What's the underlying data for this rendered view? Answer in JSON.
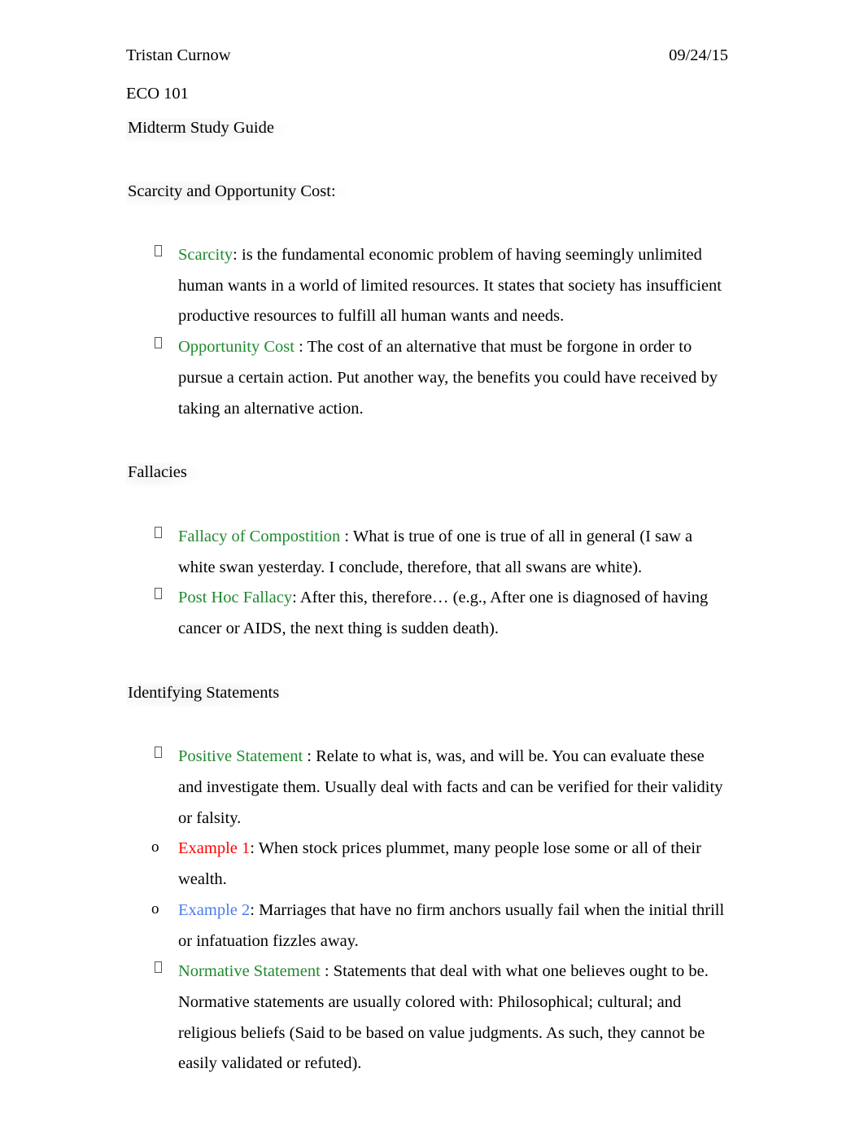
{
  "document": {
    "author": "Tristan Curnow",
    "date": "09/24/15",
    "course": "ECO 101",
    "subtitle": "Midterm Study Guide"
  },
  "sections": [
    {
      "heading": "Scarcity and Opportunity Cost:",
      "items": [
        {
          "term": "Scarcity",
          "term_color": "#1f8a2e",
          "body": ": is the fundamental economic problem of having seemingly unlimited human wants in a world of limited resources. It states that society has insufficient productive resources to fulfill all human wants and needs."
        },
        {
          "term": "Opportunity Cost ",
          "term_color": "#1f8a2e",
          "body": ": The cost of an alternative that must be forgone in order to pursue a certain action. Put another way, the benefits you could have received by taking an alternative action."
        }
      ]
    },
    {
      "heading": "Fallacies",
      "items": [
        {
          "term": "Fallacy of Compostition ",
          "term_color": "#1f8a2e",
          "body": ": What is true of one is true of all in general (I saw a white swan yesterday. I conclude, therefore, that all swans are white)."
        },
        {
          "term": "Post Hoc Fallacy",
          "term_color": "#1f8a2e",
          "body": ": After this, therefore… (e.g., After one is diagnosed of having cancer or AIDS, the next thing is sudden death)."
        }
      ]
    },
    {
      "heading": "Identifying Statements",
      "items": [
        {
          "term": "Positive Statement  ",
          "term_color": "#1f8a2e",
          "body": ": Relate to what is, was, and will be. You can evaluate these and investigate them. Usually deal with facts and can be verified for their validity or falsity.",
          "subitems": [
            {
              "term": "Example 1",
              "term_color": "#ff0000",
              "body": ": When stock prices plummet, many people lose some or all of their wealth."
            },
            {
              "term": "Example 2",
              "term_color": "#4a7bec",
              "body": ": Marriages that have no firm anchors usually fail when the initial thrill or infatuation fizzles away."
            }
          ]
        },
        {
          "term": "Normative Statement  ",
          "term_color": "#1f8a2e",
          "body": ": Statements that deal with what one believes ought to be. Normative statements are usually colored with: Philosophical; cultural; and religious beliefs (Said to be based on value judgments. As such, they cannot be easily validated or refuted)."
        }
      ]
    }
  ],
  "markers": {
    "level1": "tofu-box",
    "level2": "o"
  }
}
